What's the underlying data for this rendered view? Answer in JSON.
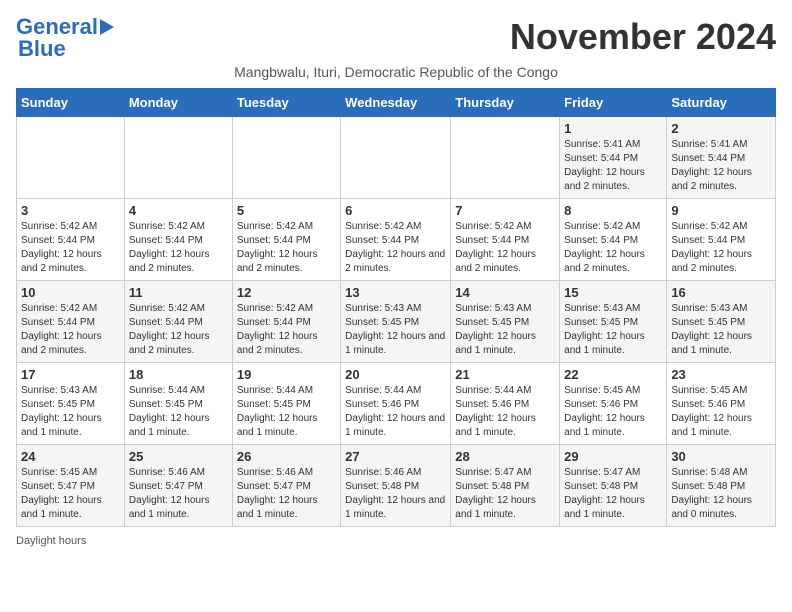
{
  "header": {
    "logo_line1": "General",
    "logo_line2": "Blue",
    "month_title": "November 2024",
    "subtitle": "Mangbwalu, Ituri, Democratic Republic of the Congo"
  },
  "days_of_week": [
    "Sunday",
    "Monday",
    "Tuesday",
    "Wednesday",
    "Thursday",
    "Friday",
    "Saturday"
  ],
  "weeks": [
    [
      {
        "day": "",
        "info": ""
      },
      {
        "day": "",
        "info": ""
      },
      {
        "day": "",
        "info": ""
      },
      {
        "day": "",
        "info": ""
      },
      {
        "day": "",
        "info": ""
      },
      {
        "day": "1",
        "info": "Sunrise: 5:41 AM\nSunset: 5:44 PM\nDaylight: 12 hours and 2 minutes."
      },
      {
        "day": "2",
        "info": "Sunrise: 5:41 AM\nSunset: 5:44 PM\nDaylight: 12 hours and 2 minutes."
      }
    ],
    [
      {
        "day": "3",
        "info": "Sunrise: 5:42 AM\nSunset: 5:44 PM\nDaylight: 12 hours and 2 minutes."
      },
      {
        "day": "4",
        "info": "Sunrise: 5:42 AM\nSunset: 5:44 PM\nDaylight: 12 hours and 2 minutes."
      },
      {
        "day": "5",
        "info": "Sunrise: 5:42 AM\nSunset: 5:44 PM\nDaylight: 12 hours and 2 minutes."
      },
      {
        "day": "6",
        "info": "Sunrise: 5:42 AM\nSunset: 5:44 PM\nDaylight: 12 hours and 2 minutes."
      },
      {
        "day": "7",
        "info": "Sunrise: 5:42 AM\nSunset: 5:44 PM\nDaylight: 12 hours and 2 minutes."
      },
      {
        "day": "8",
        "info": "Sunrise: 5:42 AM\nSunset: 5:44 PM\nDaylight: 12 hours and 2 minutes."
      },
      {
        "day": "9",
        "info": "Sunrise: 5:42 AM\nSunset: 5:44 PM\nDaylight: 12 hours and 2 minutes."
      }
    ],
    [
      {
        "day": "10",
        "info": "Sunrise: 5:42 AM\nSunset: 5:44 PM\nDaylight: 12 hours and 2 minutes."
      },
      {
        "day": "11",
        "info": "Sunrise: 5:42 AM\nSunset: 5:44 PM\nDaylight: 12 hours and 2 minutes."
      },
      {
        "day": "12",
        "info": "Sunrise: 5:42 AM\nSunset: 5:44 PM\nDaylight: 12 hours and 2 minutes."
      },
      {
        "day": "13",
        "info": "Sunrise: 5:43 AM\nSunset: 5:45 PM\nDaylight: 12 hours and 1 minute."
      },
      {
        "day": "14",
        "info": "Sunrise: 5:43 AM\nSunset: 5:45 PM\nDaylight: 12 hours and 1 minute."
      },
      {
        "day": "15",
        "info": "Sunrise: 5:43 AM\nSunset: 5:45 PM\nDaylight: 12 hours and 1 minute."
      },
      {
        "day": "16",
        "info": "Sunrise: 5:43 AM\nSunset: 5:45 PM\nDaylight: 12 hours and 1 minute."
      }
    ],
    [
      {
        "day": "17",
        "info": "Sunrise: 5:43 AM\nSunset: 5:45 PM\nDaylight: 12 hours and 1 minute."
      },
      {
        "day": "18",
        "info": "Sunrise: 5:44 AM\nSunset: 5:45 PM\nDaylight: 12 hours and 1 minute."
      },
      {
        "day": "19",
        "info": "Sunrise: 5:44 AM\nSunset: 5:45 PM\nDaylight: 12 hours and 1 minute."
      },
      {
        "day": "20",
        "info": "Sunrise: 5:44 AM\nSunset: 5:46 PM\nDaylight: 12 hours and 1 minute."
      },
      {
        "day": "21",
        "info": "Sunrise: 5:44 AM\nSunset: 5:46 PM\nDaylight: 12 hours and 1 minute."
      },
      {
        "day": "22",
        "info": "Sunrise: 5:45 AM\nSunset: 5:46 PM\nDaylight: 12 hours and 1 minute."
      },
      {
        "day": "23",
        "info": "Sunrise: 5:45 AM\nSunset: 5:46 PM\nDaylight: 12 hours and 1 minute."
      }
    ],
    [
      {
        "day": "24",
        "info": "Sunrise: 5:45 AM\nSunset: 5:47 PM\nDaylight: 12 hours and 1 minute."
      },
      {
        "day": "25",
        "info": "Sunrise: 5:46 AM\nSunset: 5:47 PM\nDaylight: 12 hours and 1 minute."
      },
      {
        "day": "26",
        "info": "Sunrise: 5:46 AM\nSunset: 5:47 PM\nDaylight: 12 hours and 1 minute."
      },
      {
        "day": "27",
        "info": "Sunrise: 5:46 AM\nSunset: 5:48 PM\nDaylight: 12 hours and 1 minute."
      },
      {
        "day": "28",
        "info": "Sunrise: 5:47 AM\nSunset: 5:48 PM\nDaylight: 12 hours and 1 minute."
      },
      {
        "day": "29",
        "info": "Sunrise: 5:47 AM\nSunset: 5:48 PM\nDaylight: 12 hours and 1 minute."
      },
      {
        "day": "30",
        "info": "Sunrise: 5:48 AM\nSunset: 5:48 PM\nDaylight: 12 hours and 0 minutes."
      }
    ]
  ],
  "footer": {
    "daylight_label": "Daylight hours"
  }
}
